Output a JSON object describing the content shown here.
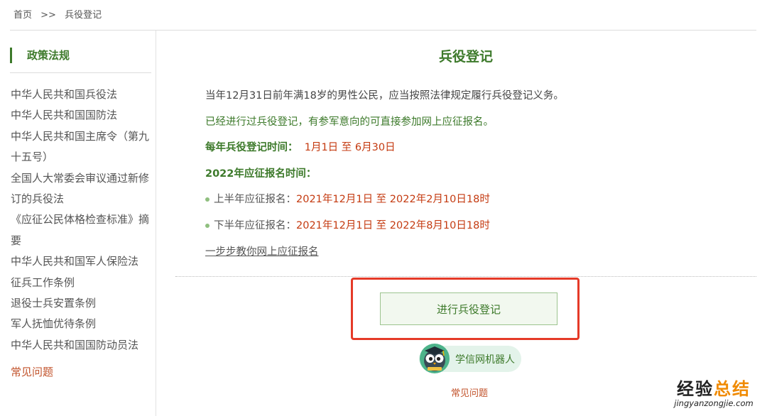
{
  "breadcrumb": {
    "home": "首页",
    "sep": ">>",
    "current": "兵役登记"
  },
  "sidebar": {
    "heading": "政策法规",
    "items": [
      "中华人民共和国兵役法",
      "中华人民共和国国防法",
      "中华人民共和国主席令（第九十五号）",
      "全国人大常委会审议通过新修订的兵役法",
      "《应征公民体格检查标准》摘要",
      "中华人民共和国军人保险法",
      "征兵工作条例",
      "退役士兵安置条例",
      "军人抚恤优待条例",
      "中华人民共和国国防动员法"
    ],
    "faq": "常见问题"
  },
  "main": {
    "title": "兵役登记",
    "para1": "当年12月31日前年满18岁的男性公民，应当按照法律规定履行兵役登记义务。",
    "para2": "已经进行过兵役登记，有参军意向的可直接参加网上应征报名。",
    "reg_time_label": "每年兵役登记时间：",
    "reg_time_value": "1月1日 至 6月30日",
    "enlist_time_label": "2022年应征报名时间：",
    "h1_label": "上半年应征报名：",
    "h1_value": "2021年12月1日 至 2022年2月10日18时",
    "h2_label": "下半年应征报名：",
    "h2_value": "2021年12月1日 至 2022年8月10日18时",
    "guide_link": "一步步教你网上应征报名",
    "register_button": "进行兵役登记",
    "robot_label": "学信网机器人",
    "faq": "常见问题"
  },
  "watermark": {
    "cn_prefix": "经验",
    "cn_suffix": "总结",
    "en": "jingyanzongjie.com"
  },
  "colors": {
    "accent_green": "#3d7a2b",
    "date_red": "#c43a10",
    "highlight_box": "#e53a28"
  }
}
